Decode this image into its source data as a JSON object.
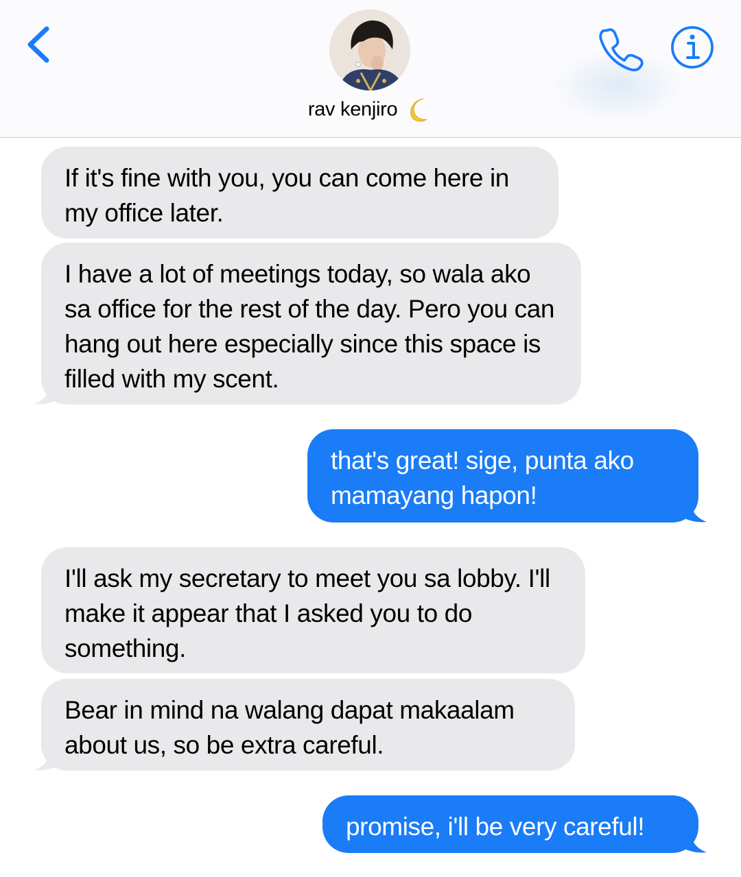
{
  "header": {
    "contact_name": "rav kenjiro",
    "contact_emoji": "🌙",
    "back_icon": "chevron-left-icon",
    "call_icon": "phone-icon",
    "info_icon": "info-icon",
    "accent_color": "#1a7cf7"
  },
  "messages": [
    {
      "direction": "incoming",
      "text": "If it's fine with you, you can come here in my office later."
    },
    {
      "direction": "incoming",
      "text": "I have a lot of meetings today, so wala ako sa office for the rest of the day. Pero you can hang out here especially since this space is filled with my scent."
    },
    {
      "direction": "outgoing",
      "text": "that's great! sige, punta ako mamayang hapon!"
    },
    {
      "direction": "incoming",
      "text": "I'll ask my secretary to meet you sa lobby. I'll make it appear that I asked you to do something."
    },
    {
      "direction": "incoming",
      "text": "Bear in mind na walang dapat makaalam about us, so be extra careful."
    },
    {
      "direction": "outgoing",
      "text": "promise, i'll be very careful!"
    }
  ],
  "colors": {
    "incoming_bubble": "#e9e9eb",
    "outgoing_bubble": "#1a7cf7"
  }
}
